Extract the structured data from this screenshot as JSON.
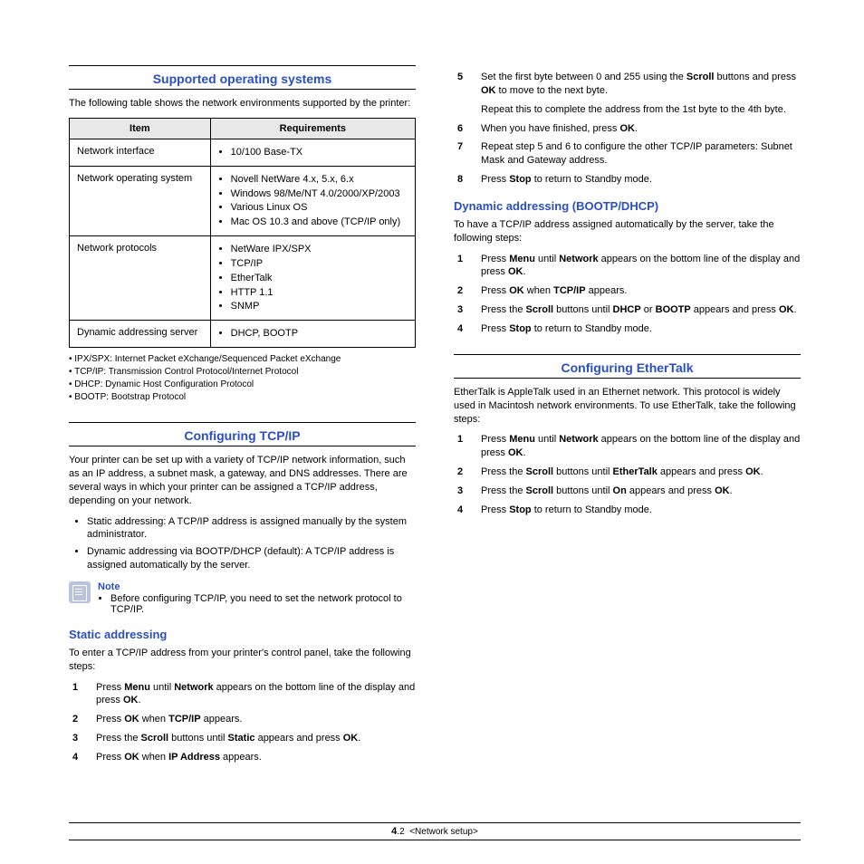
{
  "s1": {
    "title": "Supported operating systems",
    "intro": "The following table shows the network environments supported by the printer:",
    "th1": "Item",
    "th2": "Requirements",
    "r1c1": "Network interface",
    "r1i1": "10/100 Base-TX",
    "r2c1": "Network operating system",
    "r2i1": "Novell NetWare 4.x, 5.x, 6.x",
    "r2i2": "Windows 98/Me/NT 4.0/2000/XP/2003",
    "r2i3": "Various Linux OS",
    "r2i4": "Mac OS 10.3 and above (TCP/IP only)",
    "r3c1": "Network protocols",
    "r3i1": "NetWare IPX/SPX",
    "r3i2": "TCP/IP",
    "r3i3": "EtherTalk",
    "r3i4": "HTTP 1.1",
    "r3i5": "SNMP",
    "r4c1": "Dynamic addressing server",
    "r4i1": "DHCP, BOOTP",
    "n1": "• IPX/SPX: Internet Packet eXchange/Sequenced Packet eXchange",
    "n2": "• TCP/IP: Transmission Control Protocol/Internet Protocol",
    "n3": "• DHCP: Dynamic Host Configuration Protocol",
    "n4": "• BOOTP: Bootstrap Protocol"
  },
  "s2": {
    "title": "Configuring TCP/IP",
    "intro": "Your printer can be set up with a variety of TCP/IP network information, such as an IP address, a subnet mask, a gateway, and DNS addresses. There are several ways in which your printer can be assigned a TCP/IP address, depending on your network.",
    "b1": "Static addressing: A TCP/IP address is assigned manually by the system administrator.",
    "b2": "Dynamic addressing via BOOTP/DHCP (default): A TCP/IP address is assigned automatically by the server.",
    "noteTitle": "Note",
    "noteBody": "Before configuring TCP/IP, you need to set the network protocol to TCP/IP."
  },
  "s3": {
    "title": "Static addressing",
    "intro": "To enter a TCP/IP address from your printer's control panel, take the following steps:",
    "steps": {
      "1": {
        "a": "Press ",
        "b": "Menu",
        "c": " until ",
        "d": "Network",
        "e": " appears on the bottom line of the display and press ",
        "f": "OK",
        "g": "."
      },
      "2": {
        "a": "Press ",
        "b": "OK",
        "c": " when ",
        "d": "TCP/IP",
        "e": " appears."
      },
      "3": {
        "a": "Press the ",
        "b": "Scroll",
        "c": " buttons until ",
        "d": "Static",
        "e": " appears and press ",
        "f": "OK",
        "g": "."
      },
      "4": {
        "a": "Press ",
        "b": "OK",
        "c": " when ",
        "d": "IP Address",
        "e": " appears."
      },
      "5": {
        "a": "Set the first byte between 0 and 255 using the ",
        "b": "Scroll",
        "c": " buttons and press ",
        "d": "OK",
        "e": " to move to the next byte.",
        "sub": "Repeat this to complete the address from the 1st byte to the 4th byte."
      },
      "6": {
        "a": "When you have finished, press ",
        "b": "OK",
        "c": "."
      },
      "7": {
        "a": "Repeat step 5 and 6 to configure the other TCP/IP parameters: Subnet Mask and Gateway address."
      },
      "8": {
        "a": "Press ",
        "b": "Stop",
        "c": " to return to Standby mode."
      }
    }
  },
  "s4": {
    "title": "Dynamic addressing (BOOTP/DHCP)",
    "intro": "To have a TCP/IP address assigned automatically by the server, take the following steps:",
    "steps": {
      "1": {
        "a": "Press ",
        "b": "Menu",
        "c": " until ",
        "d": "Network",
        "e": " appears on the bottom line of the display and press ",
        "f": "OK",
        "g": "."
      },
      "2": {
        "a": "Press ",
        "b": "OK",
        "c": " when ",
        "d": "TCP/IP",
        "e": " appears."
      },
      "3": {
        "a": "Press the ",
        "b": "Scroll",
        "c": " buttons until ",
        "d": "DHCP",
        "e": " or ",
        "f": "BOOTP",
        "g": " appears and press ",
        "h": "OK",
        "i": "."
      },
      "4": {
        "a": "Press ",
        "b": "Stop",
        "c": " to return to Standby mode."
      }
    }
  },
  "s5": {
    "title": "Configuring EtherTalk",
    "intro": "EtherTalk is AppleTalk used in an Ethernet network. This protocol is widely used in Macintosh network environments. To use EtherTalk, take the following steps:",
    "steps": {
      "1": {
        "a": "Press ",
        "b": "Menu",
        "c": " until ",
        "d": "Network",
        "e": " appears on the bottom line of the display and press ",
        "f": "OK",
        "g": "."
      },
      "2": {
        "a": "Press the ",
        "b": "Scroll",
        "c": " buttons until ",
        "d": "EtherTalk",
        "e": " appears and press ",
        "f": "OK",
        "g": "."
      },
      "3": {
        "a": "Press the ",
        "b": "Scroll",
        "c": " buttons until ",
        "d": "On",
        "e": " appears and press ",
        "f": "OK",
        "g": "."
      },
      "4": {
        "a": "Press ",
        "b": "Stop",
        "c": " to return to Standby mode."
      }
    }
  },
  "footer": {
    "chapter": "4",
    "page": ".2",
    "label": "<Network setup>"
  }
}
